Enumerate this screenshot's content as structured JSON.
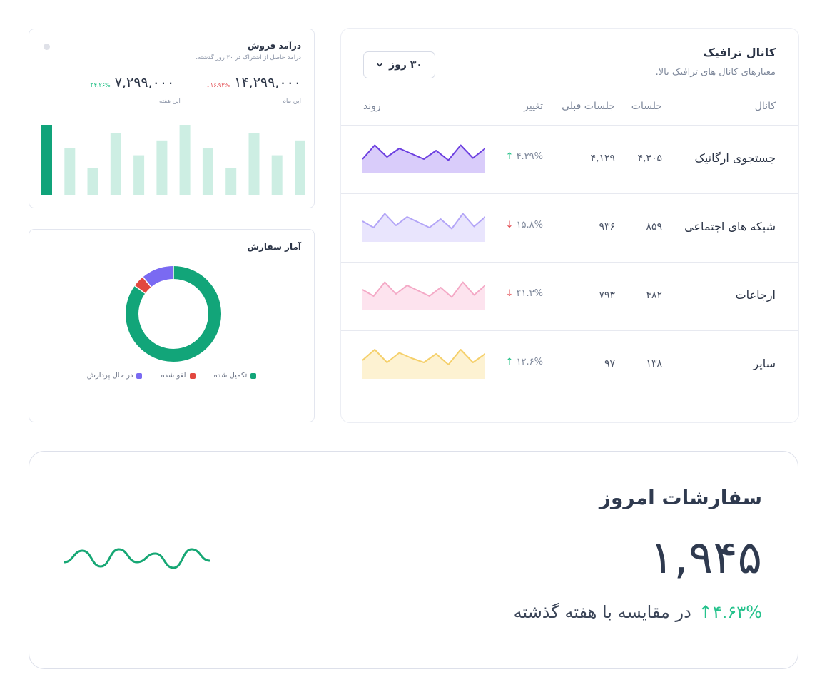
{
  "revenue": {
    "title": "درآمد فروش",
    "subtitle": "درآمد حاصل از اشتراک در ۳۰ روز گذشته.",
    "this_month": {
      "value": "۱۴,۲۹۹,۰۰۰",
      "change": "۱۶.۹۳%",
      "direction": "down",
      "label": "این ماه"
    },
    "this_week": {
      "value": "۷,۲۹۹,۰۰۰",
      "change": "۴.۲۶%",
      "direction": "up",
      "label": "این هفته"
    },
    "bars": [
      1.0,
      0.67,
      0.39,
      0.88,
      0.57,
      0.78,
      1.0,
      0.67,
      0.39,
      0.88,
      0.57,
      0.78
    ],
    "highlighted_bar_index": 0,
    "colors": {
      "highlight": "#10a37a",
      "bar": "#cdeee3"
    }
  },
  "order_stats": {
    "title": "آمار سفارش",
    "segments": [
      {
        "label": "تکمیل شده",
        "value": 85,
        "color": "#12a579"
      },
      {
        "label": "لغو شده",
        "value": 4,
        "color": "#e2473f"
      },
      {
        "label": "در حال پردازش",
        "value": 11,
        "color": "#7a6af2"
      }
    ]
  },
  "traffic": {
    "title": "کانال ترافیک",
    "subtitle": "معیارهای کانال های ترافیک بالا.",
    "range_button": "۳۰ روز",
    "headers": {
      "channel": "کانال",
      "sessions": "جلسات",
      "prev_sessions": "جلسات قبلی",
      "change": "تغییر",
      "trend": "روند"
    },
    "rows": [
      {
        "name": "جستجوی ارگانیک",
        "sessions": "۴,۳۰۵",
        "prev": "۴,۱۲۹",
        "change": "۴.۲۹%",
        "direction": "up",
        "stroke": "#6c3fe0",
        "fill": "#d9ccfa",
        "trend": [
          0.2,
          0.85,
          0.3,
          0.7,
          0.45,
          0.2,
          0.6,
          0.15,
          0.85,
          0.25,
          0.7
        ]
      },
      {
        "name": "شبکه های اجتماعی",
        "sessions": "۸۵۹",
        "prev": "۹۳۶",
        "change": "۱۵.۸%",
        "direction": "down",
        "stroke": "#b3a5f7",
        "fill": "#e9e5fd",
        "trend": [
          0.5,
          0.2,
          0.85,
          0.3,
          0.7,
          0.45,
          0.2,
          0.6,
          0.15,
          0.85,
          0.25,
          0.7
        ]
      },
      {
        "name": "ارجاعات",
        "sessions": "۴۸۲",
        "prev": "۷۹۳",
        "change": "۴۱.۳%",
        "direction": "down",
        "stroke": "#f4a9c6",
        "fill": "#fde3ee",
        "trend": [
          0.5,
          0.2,
          0.85,
          0.3,
          0.7,
          0.45,
          0.2,
          0.6,
          0.15,
          0.85,
          0.25,
          0.7
        ]
      },
      {
        "name": "سایر",
        "sessions": "۱۳۸",
        "prev": "۹۷",
        "change": "۱۲.۶%",
        "direction": "up",
        "stroke": "#f5d06b",
        "fill": "#fdf2d2",
        "trend": [
          0.4,
          0.9,
          0.3,
          0.75,
          0.5,
          0.3,
          0.7,
          0.2,
          0.9,
          0.3,
          0.7
        ]
      }
    ]
  },
  "today_orders": {
    "title": "سفارشات امروز",
    "value": "۱,۹۴۵",
    "change": "۴.۶۳%",
    "comparison": "در مقایسه با هفته گذشته",
    "trend": [
      0.35,
      0.75,
      0.2,
      0.8,
      0.35,
      0.65,
      0.15,
      0.8,
      0.4
    ],
    "color": "#16a774"
  }
}
